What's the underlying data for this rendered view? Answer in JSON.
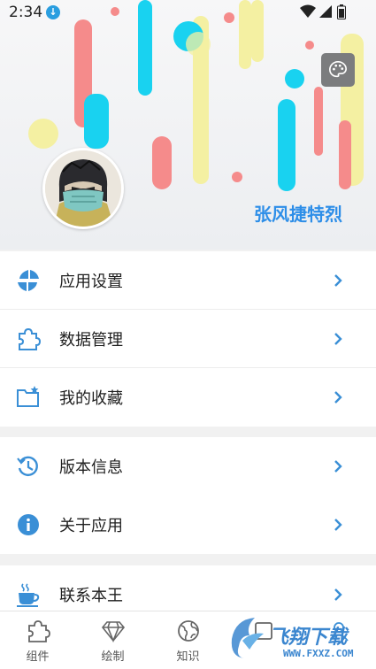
{
  "status_bar": {
    "time": "2:34",
    "download_icon": "download-icon",
    "icons": [
      "wifi-icon",
      "signal-icon",
      "battery-icon"
    ]
  },
  "header": {
    "username": "张风捷特烈",
    "palette_icon": "palette-icon",
    "avatar": "avatar",
    "colors": {
      "cyan": "#19d2f0",
      "pink": "#f58b8b",
      "yellow": "#f4f0a2",
      "username": "#2d8ee8"
    }
  },
  "menu": {
    "group1": [
      {
        "label": "应用设置",
        "icon": "settings-app-icon"
      },
      {
        "label": "数据管理",
        "icon": "puzzle-icon"
      },
      {
        "label": "我的收藏",
        "icon": "folder-star-icon"
      }
    ],
    "group2": [
      {
        "label": "版本信息",
        "icon": "history-icon"
      },
      {
        "label": "关于应用",
        "icon": "info-icon"
      }
    ],
    "group3": [
      {
        "label": "联系本王",
        "icon": "coffee-icon"
      }
    ]
  },
  "bottom_nav": [
    {
      "label": "组件",
      "icon": "widget-icon"
    },
    {
      "label": "绘制",
      "icon": "diamond-icon"
    },
    {
      "label": "知识",
      "icon": "globe-icon"
    },
    {
      "label": "",
      "icon": "collection-icon"
    },
    {
      "label": "",
      "icon": "profile-icon"
    }
  ],
  "watermark": {
    "title": "飞翔下载",
    "subtitle": "WWW.FXXZ.COM"
  },
  "accent_color": "#2d8ee8"
}
